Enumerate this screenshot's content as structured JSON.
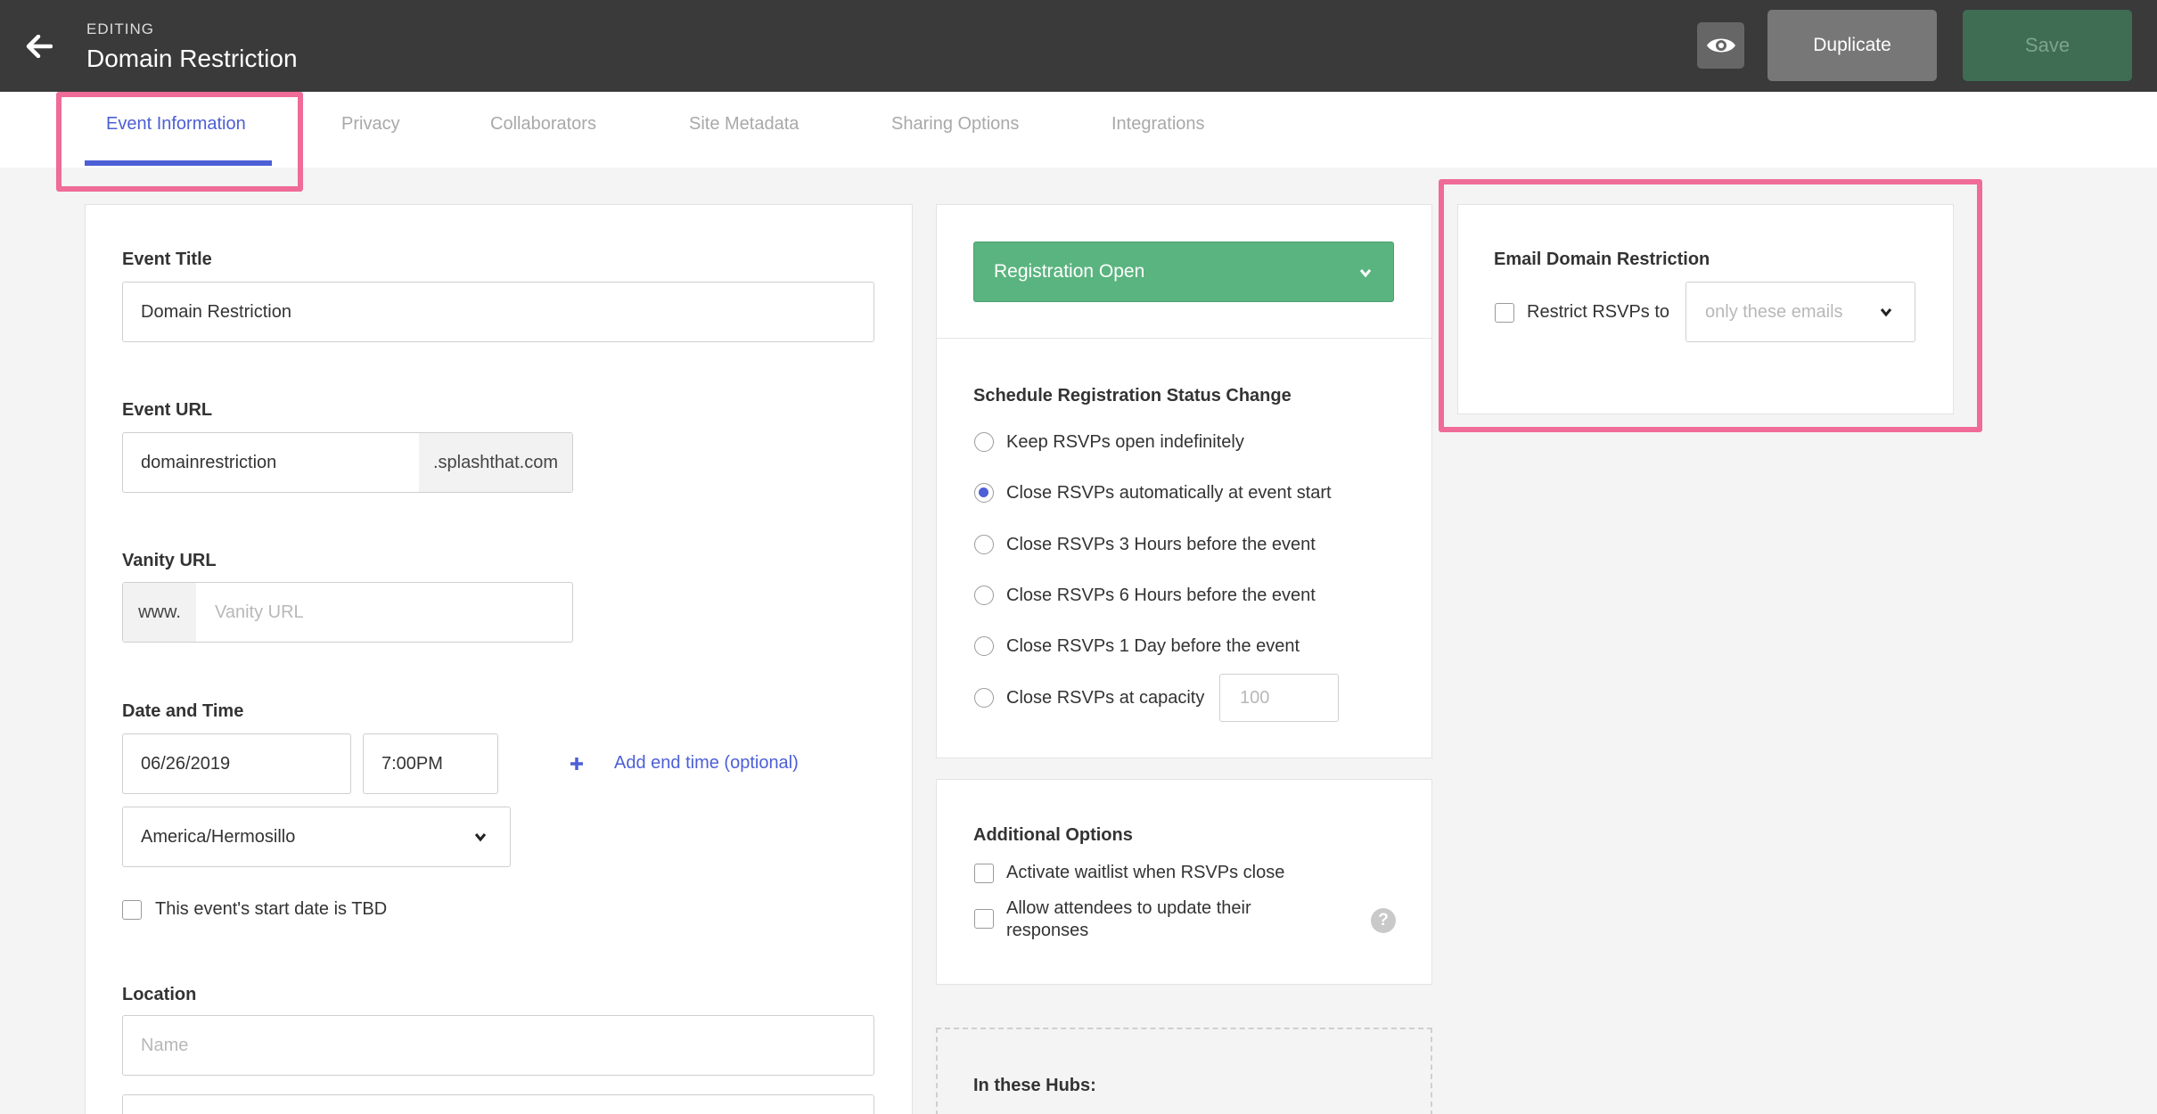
{
  "header": {
    "editing_label": "EDITING",
    "title": "Domain Restriction",
    "duplicate_label": "Duplicate",
    "save_label": "Save"
  },
  "tabs": [
    {
      "label": "Event Information",
      "active": true
    },
    {
      "label": "Privacy"
    },
    {
      "label": "Collaborators"
    },
    {
      "label": "Site Metadata"
    },
    {
      "label": "Sharing Options"
    },
    {
      "label": "Integrations"
    }
  ],
  "event_info": {
    "title_label": "Event Title",
    "title_value": "Domain Restriction",
    "url_label": "Event URL",
    "url_value": "domainrestriction",
    "url_suffix": ".splashthat.com",
    "vanity_label": "Vanity URL",
    "vanity_prefix": "www.",
    "vanity_placeholder": "Vanity URL",
    "datetime_label": "Date and Time",
    "date_value": "06/26/2019",
    "time_value": "7:00PM",
    "add_end_time": "Add end time (optional)",
    "timezone_value": "America/Hermosillo",
    "tbd_label": "This event's start date is TBD",
    "location_label": "Location",
    "location_name_placeholder": "Name"
  },
  "registration": {
    "status_label": "Registration Open",
    "schedule_label": "Schedule Registration Status Change",
    "options": [
      "Keep RSVPs open indefinitely",
      "Close RSVPs automatically at event start",
      "Close RSVPs 3 Hours before the event",
      "Close RSVPs 6 Hours before the event",
      "Close RSVPs 1 Day before the event",
      "Close RSVPs at capacity"
    ],
    "selected_option": "Close RSVPs automatically at event start",
    "capacity_placeholder": "100"
  },
  "additional_options": {
    "label": "Additional Options",
    "waitlist_label": "Activate waitlist when RSVPs close",
    "update_label_line1": "Allow attendees to update their",
    "update_label_line2": "responses",
    "help_icon_text": "?"
  },
  "hubs": {
    "label": "In these Hubs:"
  },
  "email_domain": {
    "label": "Email Domain Restriction",
    "restrict_label": "Restrict RSVPs to",
    "select_value": "only these emails"
  },
  "colors": {
    "accent": "#4c5fd5",
    "status_green": "#5ab47f",
    "highlight": "#ef6b98",
    "topbar": "#3a3a3a"
  },
  "icons": {
    "back": "arrow-left-icon",
    "preview": "eye-icon",
    "add": "plus-icon",
    "caret": "chevron-down-icon",
    "help": "question-circle-icon"
  }
}
